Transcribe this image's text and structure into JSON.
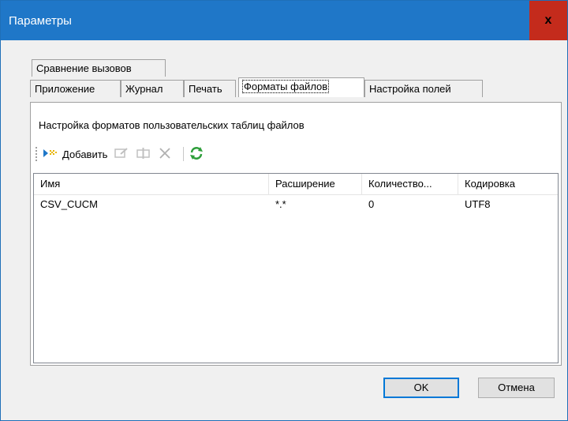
{
  "window": {
    "title": "Параметры",
    "close_glyph": "x"
  },
  "tabs": {
    "row_top": [
      {
        "label": "Сравнение вызовов"
      }
    ],
    "row_bottom": [
      {
        "label": "Приложение"
      },
      {
        "label": "Журнал"
      },
      {
        "label": "Печать"
      },
      {
        "label": "Форматы файлов",
        "active": true
      },
      {
        "label": "Настройка полей"
      }
    ]
  },
  "panel": {
    "caption": "Настройка форматов пользовательских таблиц файлов",
    "toolbar": {
      "add_label": "Добавить",
      "icons": [
        "add-icon",
        "edit-icon",
        "columns-icon",
        "delete-icon",
        "refresh-icon"
      ]
    },
    "grid": {
      "columns": [
        "Имя",
        "Расширение",
        "Количество...",
        "Кодировка"
      ],
      "rows": [
        [
          "CSV_CUCM",
          "*.*",
          "0",
          "UTF8"
        ]
      ]
    }
  },
  "buttons": {
    "ok": "OK",
    "cancel": "Отмена"
  },
  "colors": {
    "titlebar": "#1f77c8",
    "close": "#c42b1c",
    "accent": "#0078d7"
  }
}
